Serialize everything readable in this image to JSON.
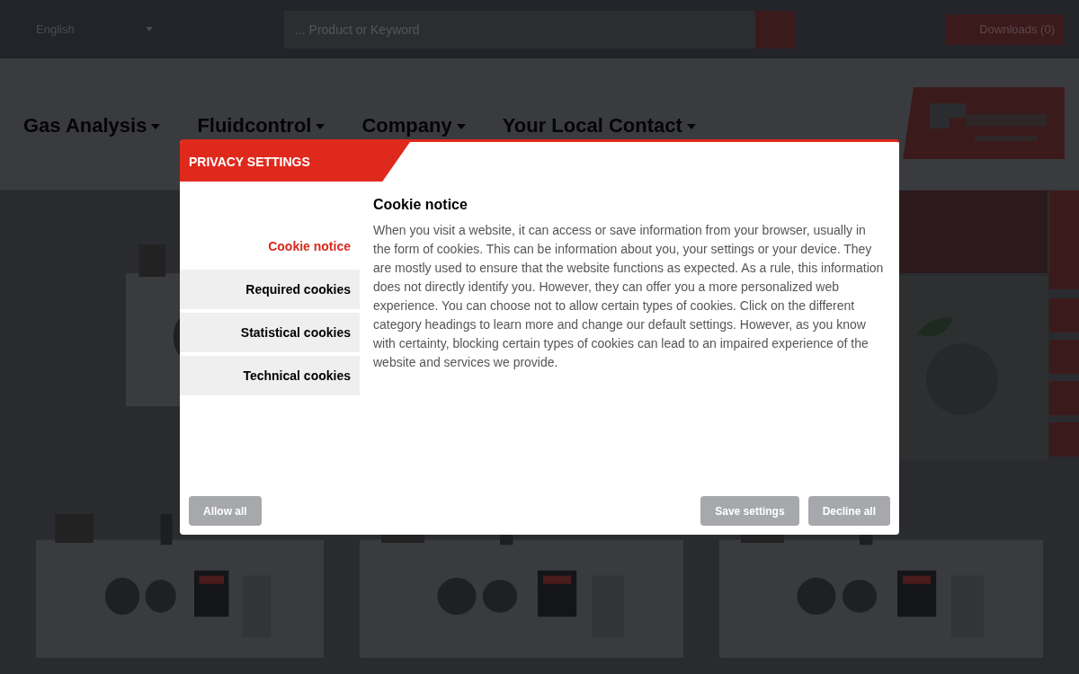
{
  "header": {
    "language": "English",
    "search": {
      "placeholder": "... Product or Keyword"
    },
    "downloads": "Downloads (0)"
  },
  "nav": [
    {
      "label": "Gas Analysis"
    },
    {
      "label": "Fluidcontrol"
    },
    {
      "label": "Company"
    },
    {
      "label": "Your Local Contact"
    }
  ],
  "dialog": {
    "title": "PRIVACY SETTINGS",
    "menu": [
      {
        "label": "Cookie notice",
        "selected": true
      },
      {
        "label": "Required cookies",
        "selected": false
      },
      {
        "label": "Statistical cookies",
        "selected": false
      },
      {
        "label": "Technical cookies",
        "selected": false
      }
    ],
    "heading": "Cookie notice",
    "body": "When you visit a website, it can access or save information from your browser, usually in the form of cookies. This can be information about you, your settings or your device. They are mostly used to ensure that the website functions as expected. As a rule, this information does not directly identify you. However, they can offer you a more personalized web experience. You can choose not to allow certain types of cookies. Click on the different category headings to learn more and change our default settings. However, as you know with certainty, blocking certain types of cookies can lead to an impaired experience of the website and services we provide.",
    "buttons": [
      {
        "label": "Allow all",
        "kind": "left"
      },
      {
        "label": "Save settings",
        "kind": "right"
      },
      {
        "label": "Decline all",
        "kind": "right"
      }
    ]
  }
}
